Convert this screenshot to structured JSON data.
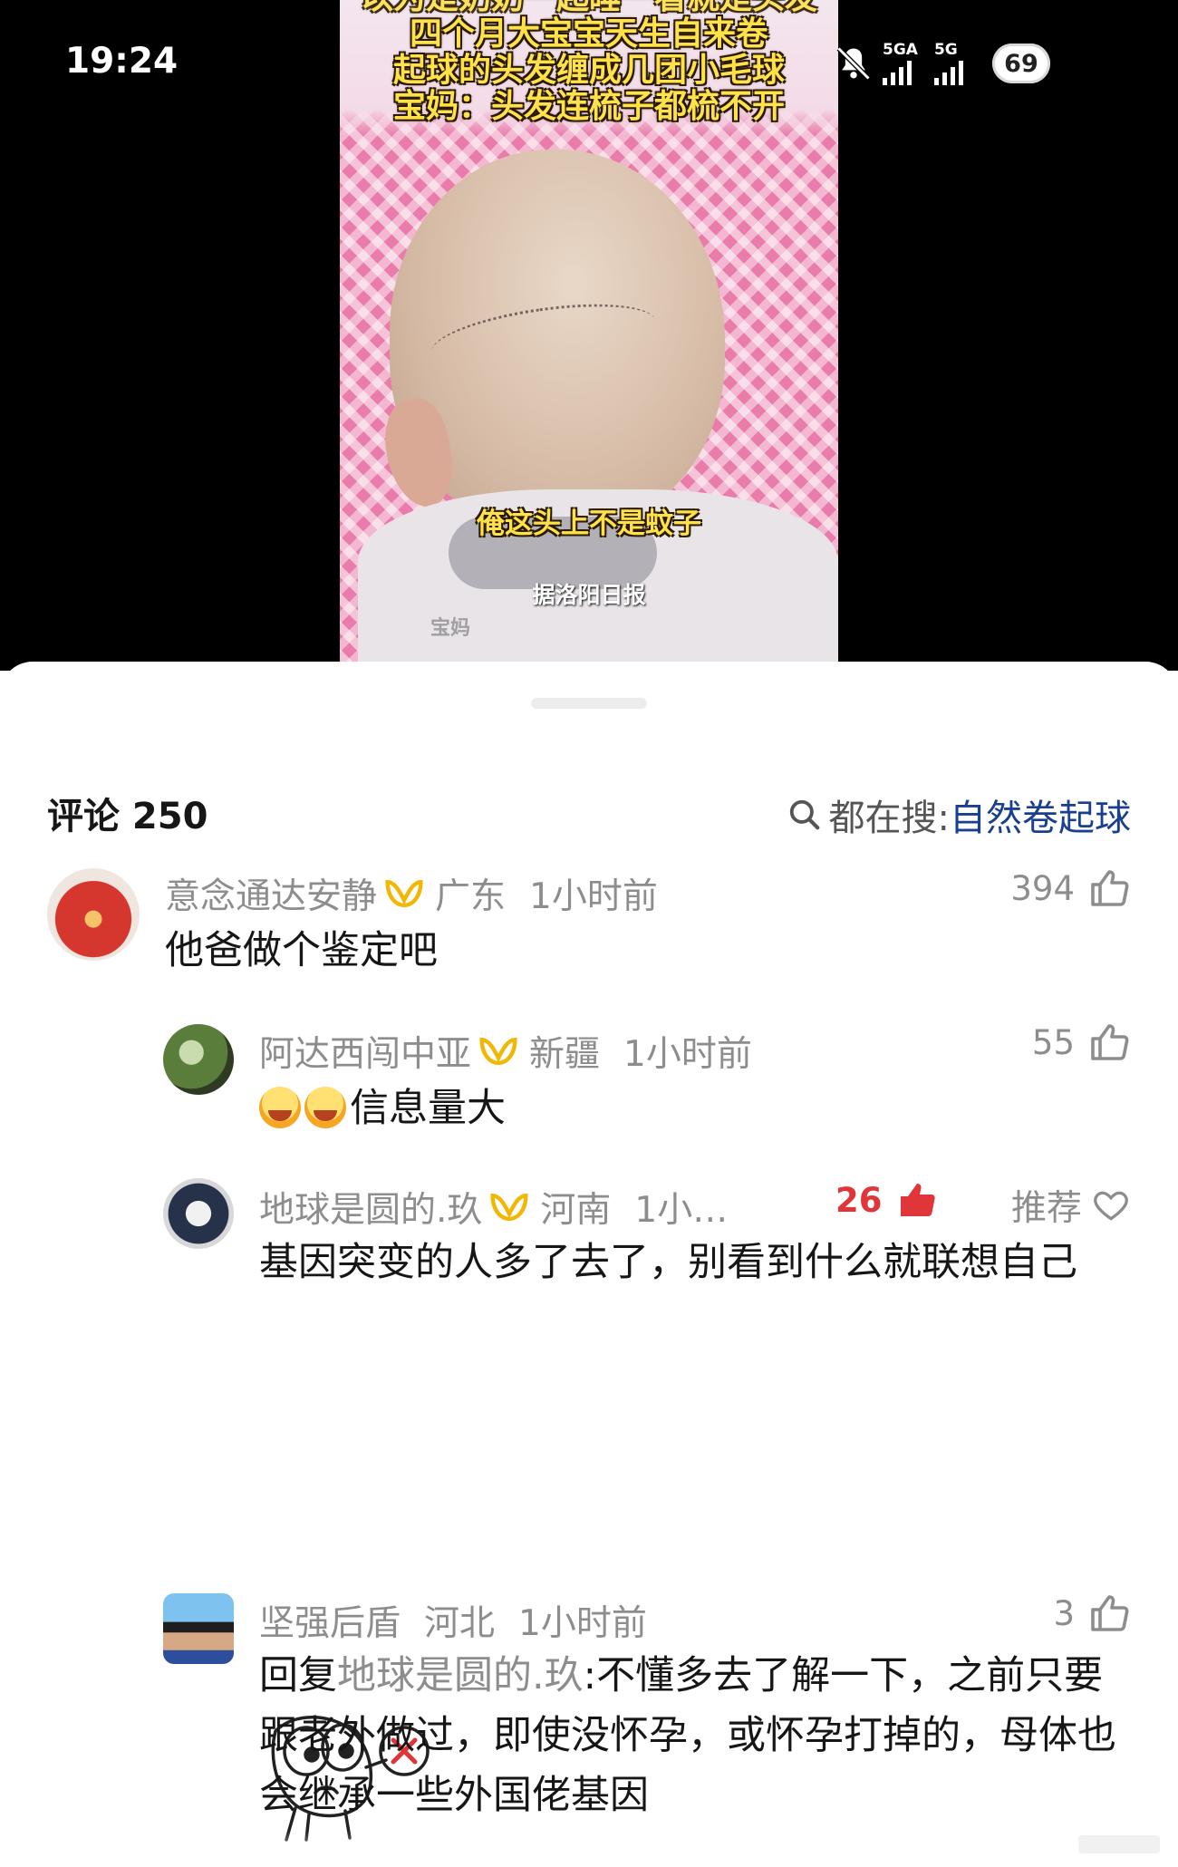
{
  "status_bar": {
    "time": "19:24",
    "signal1_label": "5GA",
    "signal2_label": "5G",
    "battery": "69"
  },
  "video": {
    "title_line0": "以为是奶奶一起睡一看就是头发",
    "title_line1": "四个月大宝宝天生自来卷",
    "title_line2": "起球的头发缠成几团小毛球",
    "title_line3": "宝妈：头发连梳子都梳不开",
    "subtitle": "俺这头上不是蚊子",
    "source": "据洛阳日报",
    "watermark": "宝妈"
  },
  "comments_header": {
    "title": "评论 250",
    "search_prefix": "都在搜:",
    "search_term": "自然卷起球"
  },
  "comments": [
    {
      "user": "意念通达安静",
      "region": "广东",
      "time": "1小时前",
      "likes": "394",
      "text": "他爸做个鉴定吧"
    },
    {
      "user": "阿达西闯中亚",
      "region": "新疆",
      "time": "1小时前",
      "likes": "55",
      "text": "信息量大"
    },
    {
      "user": "地球是圆的.玖",
      "region": "河南",
      "time": "1小…",
      "likes": "26",
      "recommend": "推荐",
      "text": "基因突变的人多了去了，别看到什么就联想自己"
    },
    {
      "user": "坚强后盾",
      "region": "河北",
      "time": "1小时前",
      "likes": "3",
      "reply_prefix": "回复",
      "reply_to": "地球是圆的.玖",
      "text": ":不懂多去了解一下，之前只要跟老外做过，即使没怀孕，或怀孕打掉的，母体也会继承一些外国佬基因"
    }
  ],
  "colors": {
    "accent_link": "#1a3f8f",
    "like_hot": "#e0363a",
    "meta_gray": "#8d8d8d",
    "badge_gold": "#f2b705"
  },
  "icons": [
    "mute-icon",
    "signal-icon",
    "battery-icon",
    "search-icon",
    "thumbs-up-icon",
    "heart-icon",
    "vip-badge-icon",
    "laughing-emoji-icon"
  ]
}
